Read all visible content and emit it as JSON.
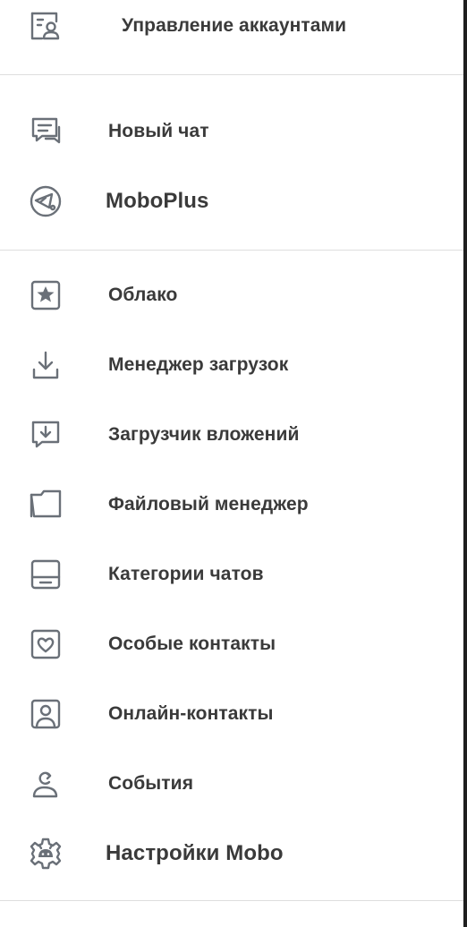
{
  "header": {
    "label": "Управление аккаунтами",
    "icon": "account-management-icon"
  },
  "menu_primary": [
    {
      "label": "Новый чат",
      "icon": "new-chat-icon"
    },
    {
      "label": "MoboPlus",
      "icon": "moboplus-icon"
    }
  ],
  "menu_secondary": [
    {
      "label": "Облако",
      "icon": "cloud-star-icon"
    },
    {
      "label": "Менеджер загрузок",
      "icon": "download-icon"
    },
    {
      "label": "Загрузчик вложений",
      "icon": "attachment-download-icon"
    },
    {
      "label": "Файловый менеджер",
      "icon": "folder-icon"
    },
    {
      "label": "Категории чатов",
      "icon": "chat-categories-icon"
    },
    {
      "label": "Особые контакты",
      "icon": "heart-contact-icon"
    },
    {
      "label": "Онлайн-контакты",
      "icon": "online-contact-icon"
    },
    {
      "label": "События",
      "icon": "events-icon"
    },
    {
      "label": "Настройки Mobo",
      "icon": "settings-gear-icon"
    }
  ],
  "colors": {
    "icon": "#6a7078",
    "text": "#3a3a3a",
    "divider": "#dedede",
    "background": "#ffffff"
  }
}
